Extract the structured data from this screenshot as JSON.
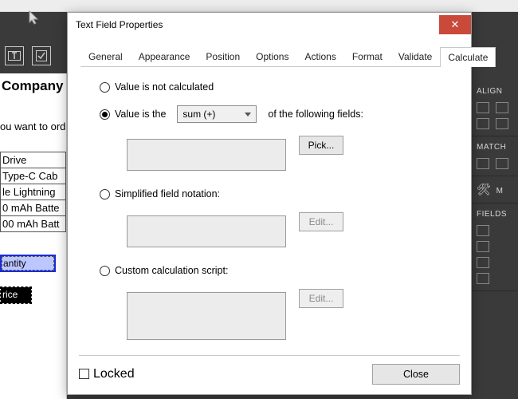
{
  "dialog": {
    "title": "Text Field Properties",
    "tabs": [
      "General",
      "Appearance",
      "Position",
      "Options",
      "Actions",
      "Format",
      "Validate",
      "Calculate"
    ],
    "active_tab": "Calculate",
    "calc": {
      "opt_not_calculated": "Value is not calculated",
      "opt_value_is_the": "Value is the",
      "combo_value": "sum (+)",
      "of_following": "of the following fields:",
      "pick_label": "Pick...",
      "opt_simplified": "Simplified field notation:",
      "opt_custom": "Custom calculation script:",
      "edit_label": "Edit..."
    },
    "locked_label": "Locked",
    "close_label": "Close"
  },
  "bg": {
    "company_label": "Company",
    "want_text": "ou want to ord",
    "rows": [
      "Drive",
      "Type-C Cab",
      "le Lightning",
      "0 mAh Batte",
      "00 mAh Batt"
    ],
    "sel_field": "antity",
    "price_field": "rice"
  },
  "rightpanel": {
    "align": "ALIGN",
    "match": "MATCH",
    "m_label": "M",
    "fields": "FIELDS"
  }
}
